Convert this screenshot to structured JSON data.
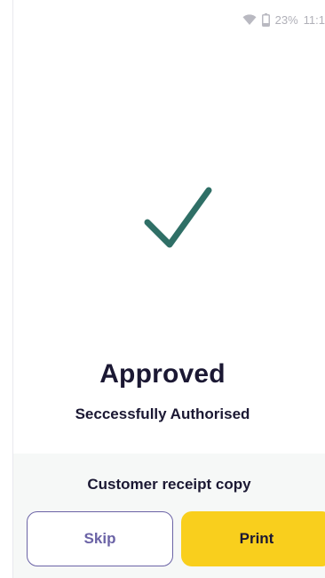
{
  "status_bar": {
    "battery": "23%",
    "time": "11:1",
    "wifi_icon": "wifi-icon",
    "battery_icon": "battery-icon"
  },
  "result": {
    "icon": "checkmark-icon",
    "icon_color": "#2f6f66",
    "title": "Approved",
    "subtitle": "Seccessfully Authorised"
  },
  "receipt": {
    "label": "Customer receipt copy",
    "skip_label": "Skip",
    "print_label": "Print"
  },
  "colors": {
    "accent_yellow": "#f9cf1d",
    "skip_purple": "#6b63a6",
    "text_dark": "#1b1833"
  }
}
